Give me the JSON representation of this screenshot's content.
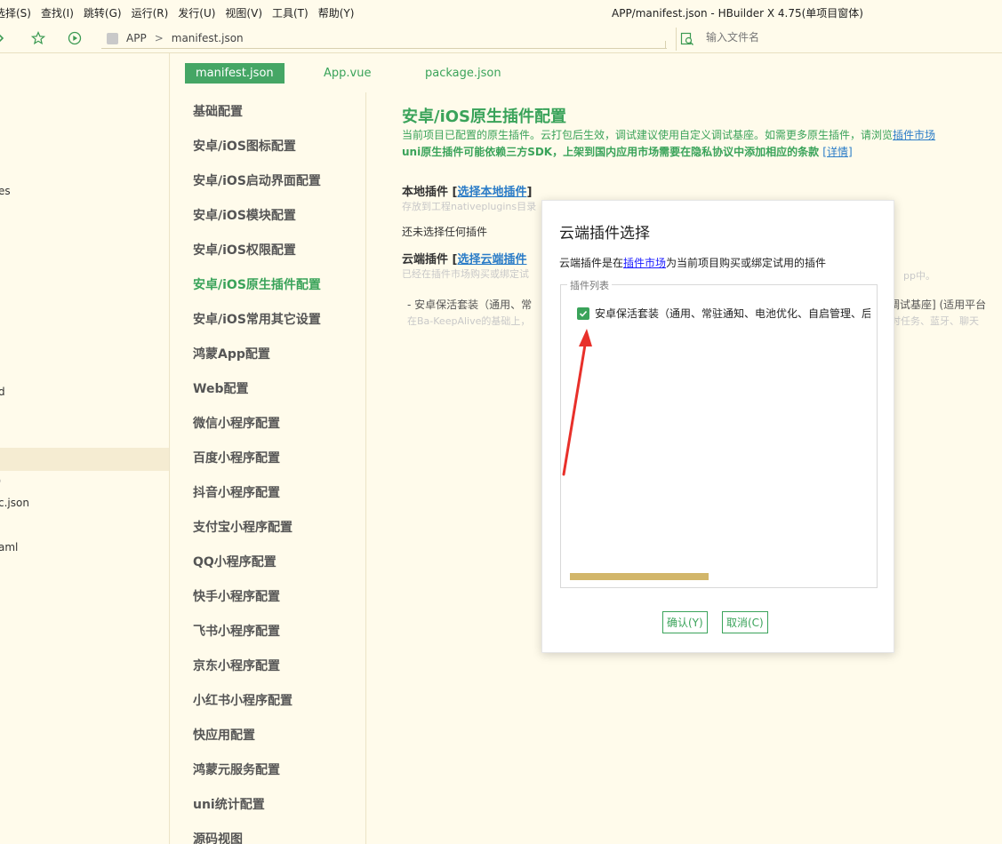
{
  "menu": [
    "选择(S)",
    "查找(I)",
    "跳转(G)",
    "运行(R)",
    "发行(U)",
    "视图(V)",
    "工具(T)",
    "帮助(Y)"
  ],
  "window_title": "APP/manifest.json - HBuilder X 4.75(单项目窗体)",
  "breadcrumb": {
    "project": "APP",
    "file": "manifest.json"
  },
  "search": {
    "placeholder": "输入文件名"
  },
  "explorer": {
    "items": [
      "es",
      "d",
      "o",
      "c.json",
      "aml"
    ]
  },
  "tabs": [
    "manifest.json",
    "App.vue",
    "package.json"
  ],
  "settings_nav": [
    "基础配置",
    "安卓/iOS图标配置",
    "安卓/iOS启动界面配置",
    "安卓/iOS模块配置",
    "安卓/iOS权限配置",
    "安卓/iOS原生插件配置",
    "安卓/iOS常用其它设置",
    "鸿蒙App配置",
    "Web配置",
    "微信小程序配置",
    "百度小程序配置",
    "抖音小程序配置",
    "支付宝小程序配置",
    "QQ小程序配置",
    "快手小程序配置",
    "飞书小程序配置",
    "京东小程序配置",
    "小红书小程序配置",
    "快应用配置",
    "鸿蒙元服务配置",
    "uni统计配置",
    "源码视图"
  ],
  "content": {
    "title": "安卓/iOS原生插件配置",
    "desc1_text": "当前项目已配置的原生插件。云打包后生效，调试建议使用自定义调试基座。如需更多原生插件，请浏览",
    "desc1_link": "插件市场",
    "desc2_text": "uni原生插件可能依赖三方SDK，上架到国内应用市场需要在隐私协议中添加相应的条款",
    "desc2_link": "[详情]",
    "local_label": "本地插件",
    "local_link": "选择本地插件",
    "local_hint": "存放到工程nativeplugins目录",
    "no_plugin": "还未选择任何插件",
    "cloud_label": "云端插件",
    "cloud_link": "选择云端插件",
    "cloud_hint": "已经在插件市场购买或绑定试",
    "cloud_hint_right": "pp中。",
    "plugin_line": "- 安卓保活套装（通用、常",
    "plugin_line_right": "义调试基座] (适用平台",
    "plugin_sub": "在Ba-KeepAlive的基础上，",
    "plugin_sub_right": "定时任务、蓝牙、聊天"
  },
  "dialog": {
    "title": "云端插件选择",
    "desc_prefix": "云端插件是在",
    "desc_link": "插件市场",
    "desc_suffix": "为当前项目购买或绑定试用的插件",
    "list_legend": "插件列表",
    "plugins": [
      {
        "name": "安卓保活套装（通用、常驻通知、电池优化、自启管理、后台运行",
        "checked": true
      }
    ],
    "confirm": "确认(Y)",
    "cancel": "取消(C)"
  },
  "colors": {
    "accent": "#3aa35a",
    "link": "#2a7cc7",
    "background": "#fffbeb",
    "annotation": "#e8302a"
  }
}
